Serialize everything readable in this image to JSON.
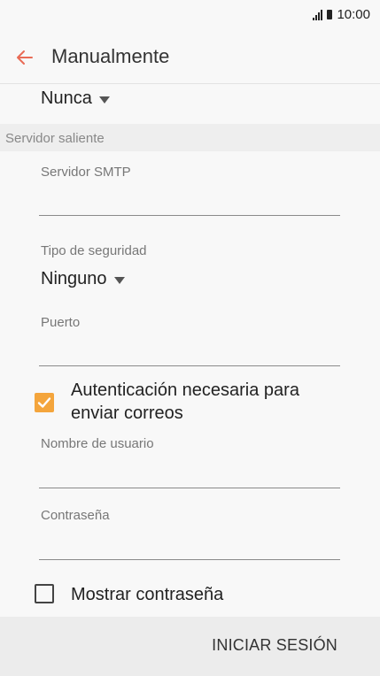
{
  "status_bar": {
    "time": "10:00"
  },
  "app_bar": {
    "title": "Manualmente",
    "accent_color": "#e96b55"
  },
  "sync": {
    "value": "Nunca"
  },
  "outgoing_server": {
    "section_title": "Servidor saliente",
    "smtp_label": "Servidor SMTP",
    "smtp_value": "",
    "security_label": "Tipo de seguridad",
    "security_value": "Ninguno",
    "port_label": "Puerto",
    "port_value": "",
    "auth_checkbox": {
      "label_line1": "Autenticación necesaria para",
      "label_line2": "enviar correos",
      "checked": true,
      "color": "#f4a53c"
    },
    "username_label": "Nombre de usuario",
    "username_value": "",
    "password_label": "Contraseña",
    "password_value": "",
    "show_password": {
      "label": "Mostrar contraseña",
      "checked": false
    }
  },
  "footer": {
    "signin_label": "INICIAR SESIÓN"
  }
}
